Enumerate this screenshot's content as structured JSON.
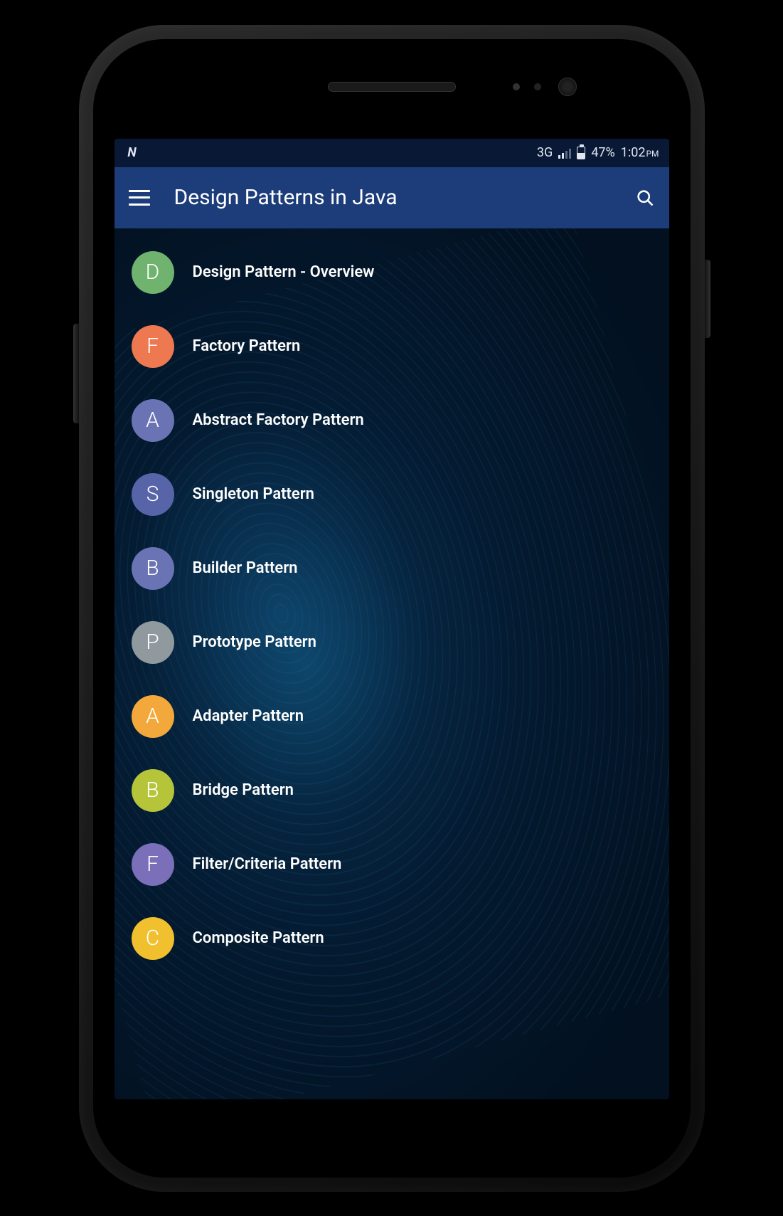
{
  "status_bar": {
    "network": "3G",
    "battery_pct": "47%",
    "time": "1:02",
    "ampm": "PM"
  },
  "app_bar": {
    "title": "Design Patterns in Java"
  },
  "list_items": [
    {
      "letter": "D",
      "label": "Design Pattern - Overview",
      "color": "#6fb36f"
    },
    {
      "letter": "F",
      "label": "Factory Pattern",
      "color": "#ee7850"
    },
    {
      "letter": "A",
      "label": "Abstract Factory Pattern",
      "color": "#6a73b4"
    },
    {
      "letter": "S",
      "label": "Singleton Pattern",
      "color": "#5864a8"
    },
    {
      "letter": "B",
      "label": "Builder Pattern",
      "color": "#6a73b4"
    },
    {
      "letter": "P",
      "label": "Prototype Pattern",
      "color": "#8f999e"
    },
    {
      "letter": "A",
      "label": "Adapter Pattern",
      "color": "#f2a83b"
    },
    {
      "letter": "B",
      "label": "Bridge Pattern",
      "color": "#b6c43a"
    },
    {
      "letter": "F",
      "label": "Filter/Criteria Pattern",
      "color": "#7a6fb8"
    },
    {
      "letter": "C",
      "label": "Composite Pattern",
      "color": "#f0c02e"
    }
  ]
}
